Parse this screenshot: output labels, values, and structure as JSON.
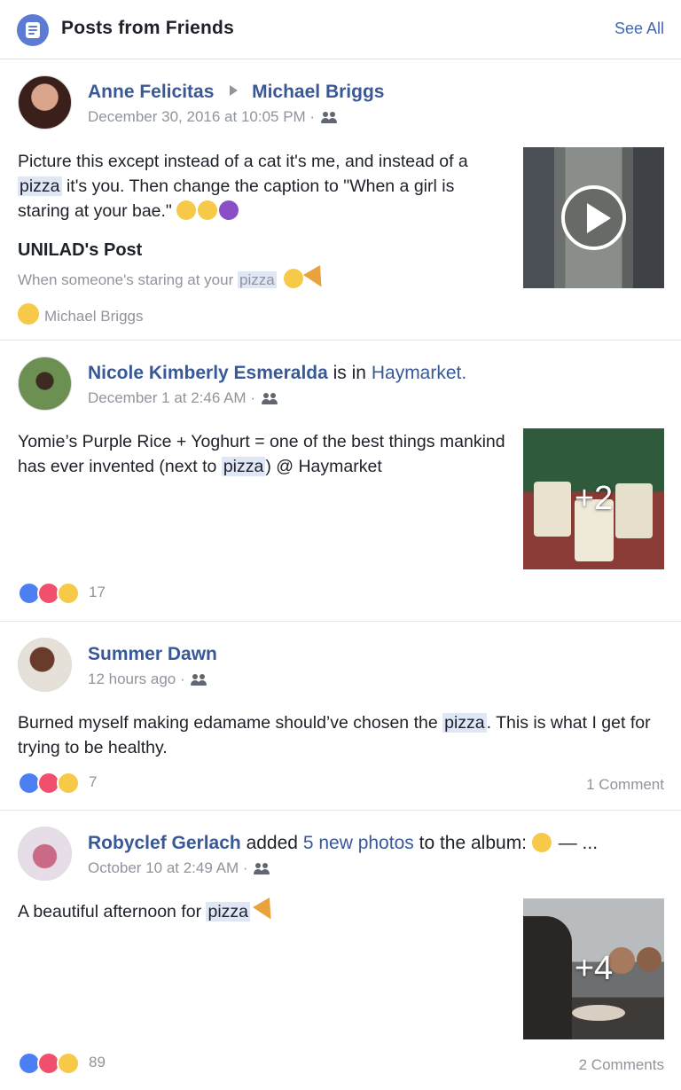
{
  "header": {
    "title": "Posts from Friends",
    "see_all": "See All"
  },
  "posts": [
    {
      "author": "Anne Felicitas",
      "target": "Michael Briggs",
      "timestamp": "December 30, 2016 at 10:05 PM ·",
      "text_parts": [
        "Picture this except instead of a cat it's me, and instead of a ",
        "pizza",
        " it's you. Then change the caption to \"When a girl is staring at your bae.\""
      ],
      "shared_title": "UNILAD's Post",
      "shared_sub_parts": [
        "When someone's staring at your ",
        "pizza"
      ],
      "reaction_name": "Michael Briggs",
      "media": "video"
    },
    {
      "author": "Nicole Kimberly Esmeralda",
      "connector": "is in",
      "place": "Haymarket.",
      "timestamp": "December 1 at 2:46 AM ·",
      "text_parts": [
        "Yomie’s Purple Rice + Yoghurt = one of the best things mankind has ever invented (next to ",
        "pizza",
        ") @ Haymarket"
      ],
      "photo_extra": "+2",
      "reaction_count": "17"
    },
    {
      "author": "Summer Dawn",
      "timestamp": "12 hours ago ·",
      "text_parts": [
        "Burned myself making edamame should’ve chosen the ",
        "pizza",
        ". This is what I get for trying to be healthy."
      ],
      "reaction_count": "7",
      "comments": "1 Comment"
    },
    {
      "author": "Robyclef Gerlach",
      "action": "added",
      "photos_link": "5 new photos",
      "album_text": "to the album:",
      "trailing": "— ...",
      "timestamp": "October 10 at 2:49 AM ·",
      "text_parts": [
        "A beautiful afternoon for ",
        "pizza"
      ],
      "photo_extra": "+4",
      "reaction_count": "89",
      "comments": "2 Comments"
    }
  ],
  "colors": {
    "link": "#385898",
    "meta": "#90949c",
    "highlight": "#dfe6f5",
    "header_icon": "#5b7bd5"
  }
}
